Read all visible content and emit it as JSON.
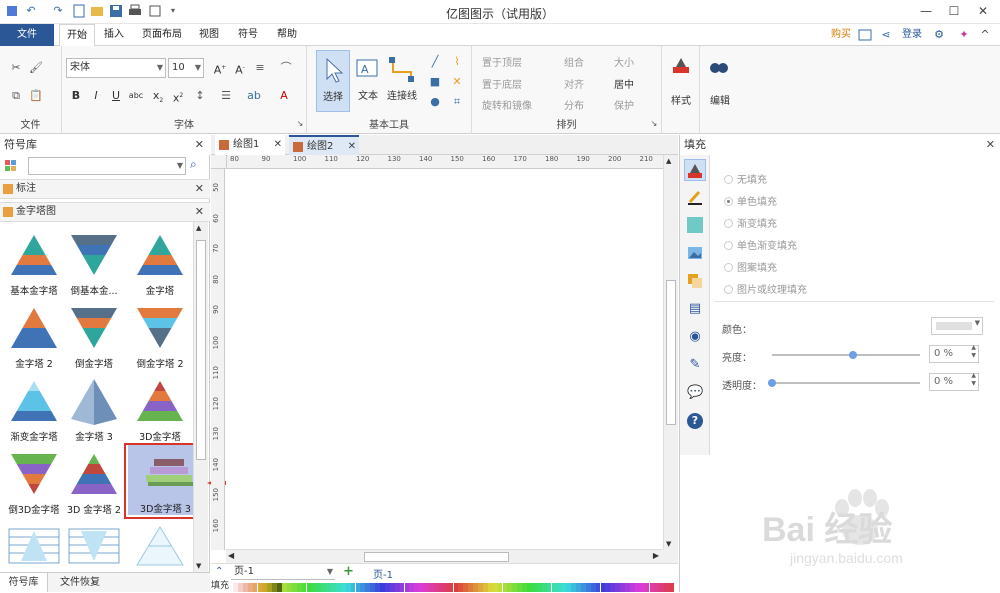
{
  "app": {
    "title": "亿图图示（试用版）",
    "header_links": {
      "buy": "购买",
      "login": "登录"
    }
  },
  "menu": {
    "file": "文件",
    "tabs": [
      "开始",
      "插入",
      "页面布局",
      "视图",
      "符号",
      "帮助"
    ]
  },
  "ribbon": {
    "groups": {
      "file": "文件",
      "font": "字体",
      "basic_tools": "基本工具",
      "arrange": "排列"
    },
    "font_name": "宋体",
    "font_size": "10",
    "tools": {
      "select": "选择",
      "text": "文本",
      "connector": "连接线"
    },
    "arrange_items": [
      "置于顶层",
      "置于底层",
      "旋转和镜像",
      "组合",
      "对齐",
      "分布",
      "大小",
      "居中",
      "保护"
    ],
    "style": "样式",
    "edit": "编辑"
  },
  "symbol_library": {
    "title": "符号库",
    "search_placeholder": "",
    "sections": [
      "标注",
      "金字塔图"
    ],
    "shapes": [
      {
        "label": "基本金字塔",
        "kind": "tri"
      },
      {
        "label": "倒基本金...",
        "kind": "inv"
      },
      {
        "label": "金字塔",
        "kind": "tri"
      },
      {
        "label": "金字塔 2",
        "kind": "tri2"
      },
      {
        "label": "倒金字塔",
        "kind": "inv2"
      },
      {
        "label": "倒金字塔 2",
        "kind": "inv3"
      },
      {
        "label": "渐变金字塔",
        "kind": "grad"
      },
      {
        "label": "金字塔 3",
        "kind": "p3"
      },
      {
        "label": "3D金字塔",
        "kind": "3d"
      },
      {
        "label": "倒3D金字塔",
        "kind": "inv3d"
      },
      {
        "label": "3D 金字塔 2",
        "kind": "3d2"
      },
      {
        "label": "3D金字塔 3",
        "kind": "3d3"
      },
      {
        "label": "",
        "kind": "table"
      },
      {
        "label": "",
        "kind": "invtable"
      },
      {
        "label": "",
        "kind": "outline"
      }
    ],
    "bottom_tabs": [
      "符号库",
      "文件恢复"
    ]
  },
  "document_tabs": [
    "绘图1",
    "绘图2"
  ],
  "ruler": {
    "h_ticks": [
      "80",
      "90",
      "100",
      "110",
      "120",
      "130",
      "140",
      "150",
      "160",
      "170",
      "180",
      "190",
      "200",
      "210"
    ],
    "v_ticks": [
      "50",
      "60",
      "70",
      "80",
      "90",
      "100",
      "110",
      "120",
      "130",
      "140",
      "150",
      "160"
    ]
  },
  "page_bar": {
    "page_select": "页-1",
    "page_tab": "页-1",
    "fill_label": "填充"
  },
  "fill_panel": {
    "title": "填充",
    "options": [
      "无填充",
      "单色填充",
      "渐变填充",
      "单色渐变填充",
      "图案填充",
      "图片或纹理填充"
    ],
    "color_label": "颜色：",
    "brightness_label": "亮度：",
    "transparency_label": "透明度：",
    "brightness_value": "0 %",
    "transparency_value": "0 %",
    "brightness_level": 0.55,
    "transparency_level": 0.0
  },
  "watermark": {
    "brand": "Bai  经验",
    "url": "jingyan.baidu.com"
  },
  "colors": {
    "file_tab": "#2b5797",
    "highlight": "#d9342b",
    "selected_tile": "#b8c4e8"
  }
}
